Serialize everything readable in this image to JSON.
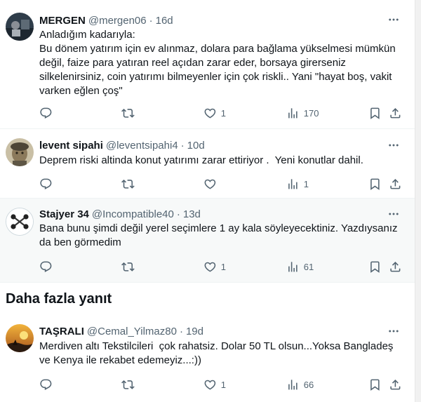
{
  "replies": [
    {
      "name": "MERGEN",
      "handle": "@mergen06",
      "separator": "·",
      "time": "16d",
      "text": "Anladığım kadarıyla:\nBu dönem yatırım için ev alınmaz, dolara para bağlama yükselmesi mümkün değil, faize para yatıran reel açıdan zarar eder, borsaya girerseniz silkelenirsiniz, coin yatırımı bilmeyen­ler için çok riskli.. Yani \"hayat boş, vakit varken eğlen çoş\"",
      "replies_count": "",
      "reposts_count": "",
      "likes_count": "1",
      "views_count": "170"
    },
    {
      "name": "levent sipahi",
      "handle": "@leventsipahi4",
      "separator": "·",
      "time": "10d",
      "text": "Deprem riski altinda konut yatırımı zarar ettiriyor .  Yeni konutlar dahil.",
      "replies_count": "",
      "reposts_count": "",
      "likes_count": "",
      "views_count": "1"
    },
    {
      "name": "Stajyer 34",
      "handle": "@Incompatible40",
      "separator": "·",
      "time": "13d",
      "text": "Bana bunu şimdi değil yerel seçimlere 1 ay kala söyleyecektiniz. Yazdıysanız da ben görmedim",
      "replies_count": "",
      "reposts_count": "",
      "likes_count": "1",
      "views_count": "61"
    },
    {
      "name": "TAŞRALI",
      "handle": "@Cemal_Yilmaz80",
      "separator": "·",
      "time": "19d",
      "text": "Merdiven altı Tekstilcileri  çok rahatsiz. Dolar 50 TL olsun...Yoksa Bangladeş ve Kenya ile rekabet edemeyiz...:))",
      "replies_count": "",
      "reposts_count": "",
      "likes_count": "1",
      "views_count": "66"
    }
  ],
  "more_replies_title": "Daha fazla yanıt",
  "icons": [
    "reply-icon",
    "repost-icon",
    "like-icon",
    "views-icon",
    "bookmark-icon",
    "share-icon",
    "more-icon"
  ],
  "colors": {
    "text": "#0f1419",
    "secondary": "#536471",
    "hover_bg": "#f7f9f9",
    "divider": "#eff3f4"
  }
}
